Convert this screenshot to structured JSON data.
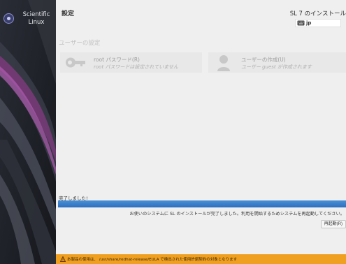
{
  "sidebar": {
    "logo_text": "Scientific Linux"
  },
  "header": {
    "page_title": "設定",
    "install_title": "SL 7 のインストール",
    "keyboard_layout": "jp"
  },
  "user_settings": {
    "section_title": "ユーザーの設定",
    "root_spoke": {
      "title": "root パスワード(R)",
      "status": "root パスワードは設定されていません"
    },
    "user_spoke": {
      "title": "ユーザーの作成(U)",
      "status": "ユーザー guest が作成されます"
    }
  },
  "progress": {
    "label": "完了しました!",
    "value": 1.0,
    "message": "お使いのシステムに SL のインストールが完了しました。利用を開始するためシステムを再起動してください。",
    "reboot_label": "再起動(R)"
  },
  "license_bar": {
    "text": "本製品の使用は、 /usr/share/redhat-release/EULA で検出された使用許諾契約の対象となります"
  },
  "colors": {
    "progress_fill": "#2f6fbe",
    "license_bar": "#f0a021",
    "sidebar_bg": "#1d2129"
  }
}
